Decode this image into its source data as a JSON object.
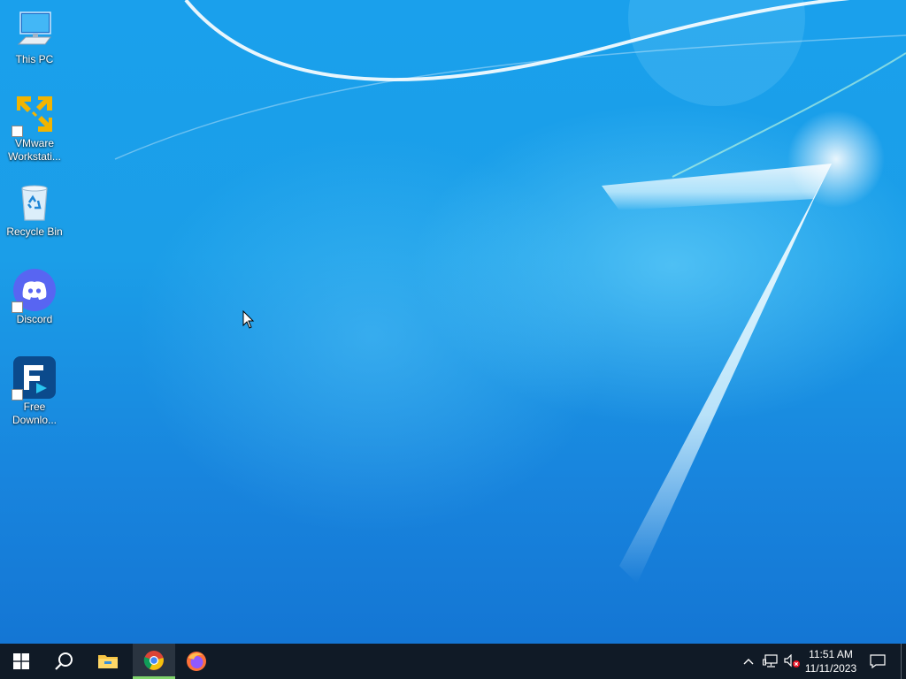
{
  "desktop": {
    "icons": [
      {
        "label": "This PC",
        "icon": "this-pc-icon"
      },
      {
        "label": "VMware\nWorkstati...",
        "icon": "vmware-icon"
      },
      {
        "label": "Recycle Bin",
        "icon": "recycle-bin-icon"
      },
      {
        "label": "Discord",
        "icon": "discord-icon"
      },
      {
        "label": "Free\nDownlo...",
        "icon": "free-download-manager-icon"
      }
    ]
  },
  "taskbar": {
    "buttons": [
      "windows-start-icon",
      "search-icon",
      "file-explorer-icon",
      "chrome-icon",
      "firefox-icon"
    ],
    "active": "chrome-icon",
    "tray": [
      "chevron-up-icon",
      "network-icon",
      "volume-muted-icon"
    ],
    "clock": {
      "time": "11:51 AM",
      "date": "11/11/2023"
    },
    "notification": "action-center-icon"
  },
  "colors": {
    "taskbar_bg": "#101a26",
    "active_indicator": "#7fd36b",
    "desktop_base": "#1a9bea"
  }
}
